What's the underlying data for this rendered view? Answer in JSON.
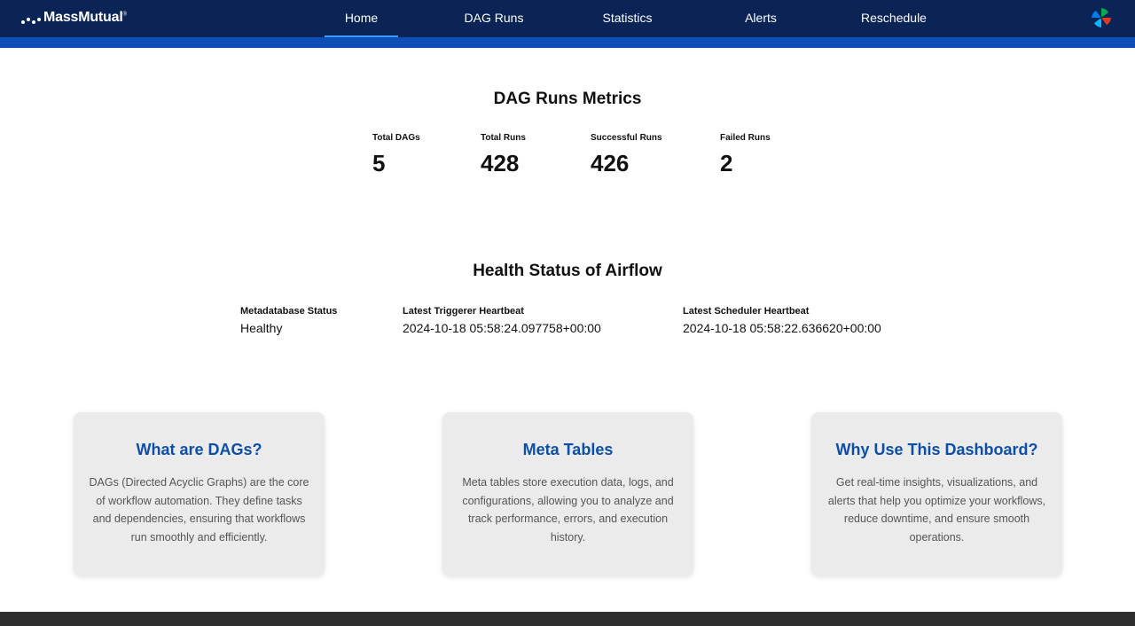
{
  "brand": {
    "name": "MassMutual",
    "mark": "®"
  },
  "nav": {
    "items": [
      {
        "label": "Home",
        "active": true
      },
      {
        "label": "DAG Runs",
        "active": false
      },
      {
        "label": "Statistics",
        "active": false
      },
      {
        "label": "Alerts",
        "active": false
      },
      {
        "label": "Reschedule",
        "active": false
      }
    ],
    "app_icon": "airflow-pinwheel-icon"
  },
  "metrics": {
    "title": "DAG Runs Metrics",
    "items": [
      {
        "label": "Total DAGs",
        "value": "5"
      },
      {
        "label": "Total Runs",
        "value": "428"
      },
      {
        "label": "Successful Runs",
        "value": "426"
      },
      {
        "label": "Failed Runs",
        "value": "2"
      }
    ]
  },
  "health": {
    "title": "Health Status of Airflow",
    "items": [
      {
        "label": "Metadatabase Status",
        "value": "Healthy"
      },
      {
        "label": "Latest Triggerer Heartbeat",
        "value": "2024-10-18 05:58:24.097758+00:00"
      },
      {
        "label": "Latest Scheduler Heartbeat",
        "value": "2024-10-18 05:58:22.636620+00:00"
      }
    ]
  },
  "cards": [
    {
      "title": "What are DAGs?",
      "body": "DAGs (Directed Acyclic Graphs) are the core of workflow automation. They define tasks and dependencies, ensuring that workflows run smoothly and efficiently."
    },
    {
      "title": "Meta Tables",
      "body": "Meta tables store execution data, logs, and configurations, allowing you to analyze and track performance, errors, and execution history."
    },
    {
      "title": "Why Use This Dashboard?",
      "body": "Get real-time insights, visualizations, and alerts that help you optimize your workflows, reduce downtime, and ensure smooth operations."
    }
  ],
  "colors": {
    "nav_bg": "#0a2455",
    "accent": "#0d4fb6",
    "card_title": "#0d4fa6",
    "card_bg": "#ebebeb",
    "footer_bg": "#2d2d2d"
  }
}
